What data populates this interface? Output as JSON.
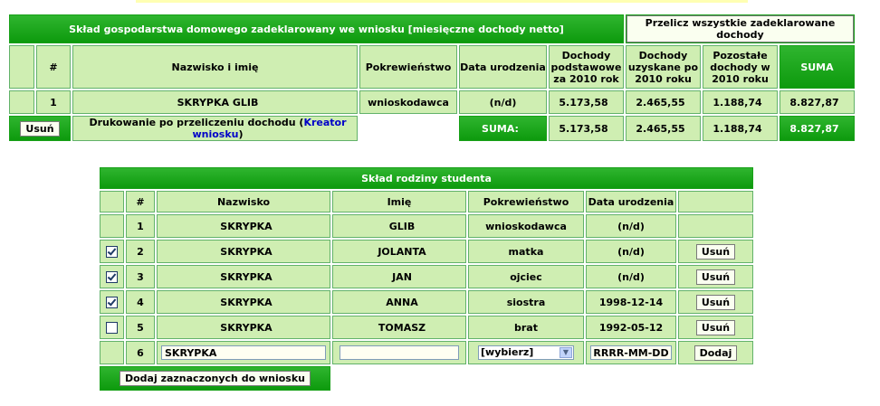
{
  "household": {
    "title": "Skład gospodarstwa domowego zadeklarowany we wniosku [miesięczne dochody netto]",
    "recalc_button": "Przelicz wszystkie zadeklarowane dochody",
    "headers": {
      "num": "#",
      "name": "Nazwisko i imię",
      "relation": "Pokrewieństwo",
      "birth": "Data urodzenia",
      "income_base": "Dochody podstawowe za 2010 rok",
      "income_obtained": "Dochody uzyskane po 2010 roku",
      "income_other": "Pozostałe dochody w 2010 roku",
      "sum": "SUMA"
    },
    "rows": [
      {
        "num": "1",
        "name": "SKRYPKA GLIB",
        "relation": "wnioskodawca",
        "birth": "(n/d)",
        "income_base": "5.173,58",
        "income_obtained": "2.465,55",
        "income_other": "1.188,74",
        "sum": "8.827,87"
      }
    ],
    "footer": {
      "delete_button": "Usuń",
      "print_text": "Drukowanie po przeliczeniu dochodu (",
      "wizard_link": "Kreator wniosku",
      "print_text_end": ")",
      "sum_label": "SUMA:",
      "income_base": "5.173,58",
      "income_obtained": "2.465,55",
      "income_other": "1.188,74",
      "sum": "8.827,87"
    }
  },
  "family": {
    "title": "Skład rodziny studenta",
    "headers": {
      "num": "#",
      "surname": "Nazwisko",
      "firstname": "Imię",
      "relation": "Pokrewieństwo",
      "birth": "Data urodzenia"
    },
    "rows": [
      {
        "num": "1",
        "surname": "SKRYPKA",
        "firstname": "GLIB",
        "relation": "wnioskodawca",
        "birth": "(n/d)"
      },
      {
        "num": "2",
        "surname": "SKRYPKA",
        "firstname": "JOLANTA",
        "relation": "matka",
        "birth": "(n/d)",
        "delete": "Usuń"
      },
      {
        "num": "3",
        "surname": "SKRYPKA",
        "firstname": "JAN",
        "relation": "ojciec",
        "birth": "(n/d)",
        "delete": "Usuń"
      },
      {
        "num": "4",
        "surname": "SKRYPKA",
        "firstname": "ANNA",
        "relation": "siostra",
        "birth": "1998-12-14",
        "delete": "Usuń"
      },
      {
        "num": "5",
        "surname": "SKRYPKA",
        "firstname": "TOMASZ",
        "relation": "brat",
        "birth": "1992-05-12",
        "delete": "Usuń"
      }
    ],
    "new_row": {
      "num": "6",
      "surname_value": "SKRYPKA",
      "firstname_value": "",
      "relation_selected": "[wybierz]",
      "birth_value": "RRRR-MM-DD",
      "add_button": "Dodaj"
    },
    "add_selected_button": "Dodaj zaznaczonych do wniosku"
  }
}
